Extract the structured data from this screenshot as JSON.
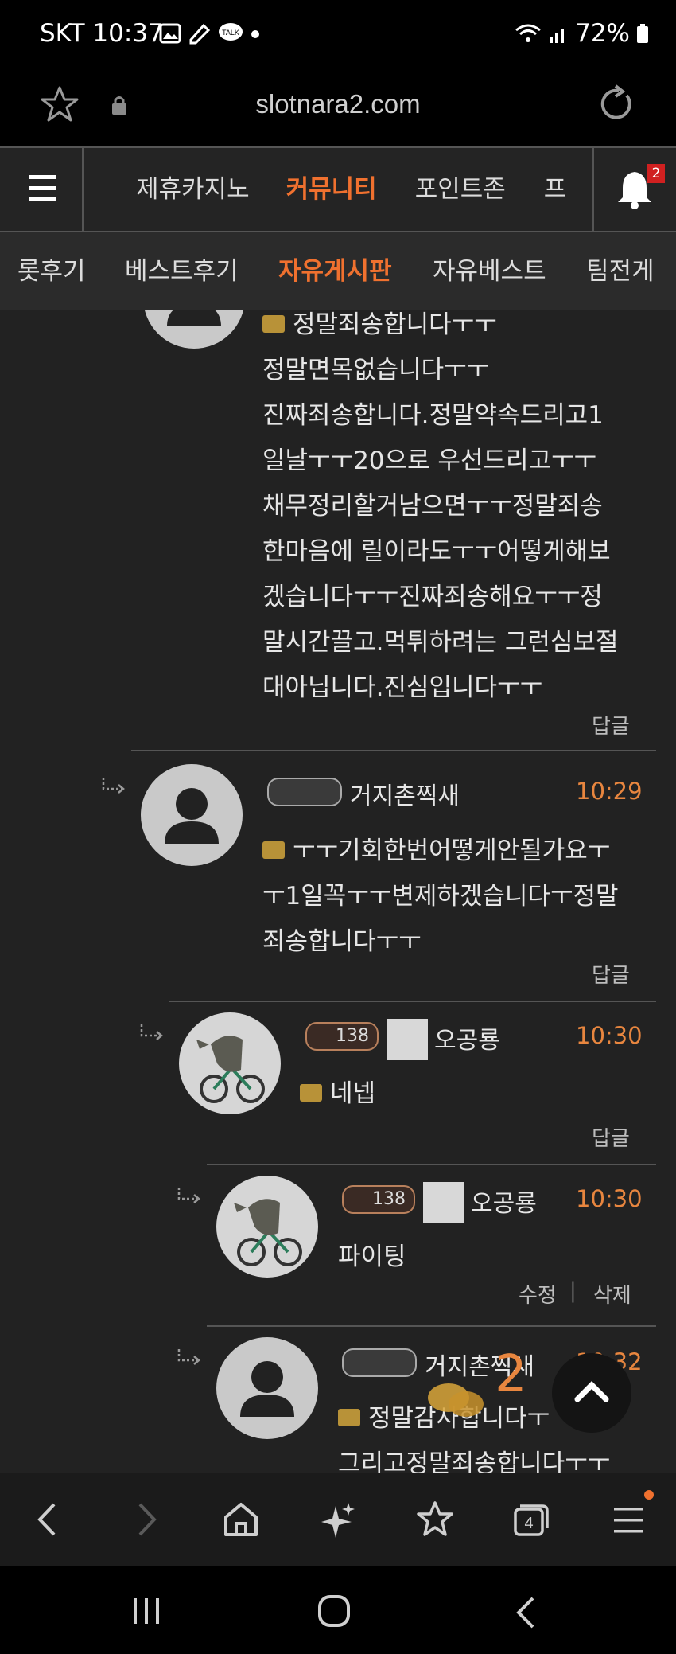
{
  "status_bar": {
    "carrier_time": "SKT 10:37",
    "battery": "72%"
  },
  "url_bar": {
    "domain": "slotnara2.com"
  },
  "site_nav": {
    "items": [
      {
        "label": "제휴카지노"
      },
      {
        "label": "커뮤니티",
        "active": true
      },
      {
        "label": "포인트존"
      },
      {
        "label": "프"
      }
    ],
    "notification_count": "2"
  },
  "sub_nav": {
    "items": [
      {
        "label": "롯후기"
      },
      {
        "label": "베스트후기"
      },
      {
        "label": "자유게시판",
        "active": true
      },
      {
        "label": "자유베스트"
      },
      {
        "label": "팀전게"
      }
    ]
  },
  "comments": [
    {
      "lines": [
        "정말죄송합니다ㅜㅜ",
        "정말면목없습니다ㅜㅜ",
        "진짜죄송합니다.정말약속드리고1",
        "일날ㅜㅜ20으로 우선드리고ㅜㅜ",
        "채무정리할거남으면ㅜㅜ정말죄송",
        "한마음에 릴이라도ㅜㅜ어떻게해보",
        "겠습니다ㅜㅜ진짜죄송해요ㅜㅜ정",
        "말시간끌고.먹튀하려는 그런심보절",
        "대아닙니다.진심입니다ㅜㅜ"
      ],
      "reply_label": "답글"
    },
    {
      "author": "거지촌찍새",
      "time": "10:29",
      "lines": [
        "ㅜㅜ기회한번어떻게안될가요ㅜ",
        "ㅜ1일꼭ㅜㅜ변제하겠습니다ㅜ정말",
        "죄송합니다ㅜㅜ"
      ],
      "reply_label": "답글"
    },
    {
      "author": "오공룡",
      "level": "138",
      "time": "10:30",
      "lines": [
        "네넵"
      ],
      "reply_label": "답글"
    },
    {
      "author": "오공룡",
      "level": "138",
      "time": "10:30",
      "lines": [
        "파이팅"
      ],
      "edit_label": "수정",
      "delete_label": "삭제"
    },
    {
      "author": "거지촌찍새",
      "time": "10:32",
      "lines": [
        "정말감사합니다ㅜ",
        "그리고정말죄송합니다ㅜㅜ"
      ]
    }
  ],
  "floating": {
    "comment_count": "2"
  },
  "colors": {
    "accent": "#f0712f",
    "time": "#e8863f",
    "background": "#222222"
  }
}
